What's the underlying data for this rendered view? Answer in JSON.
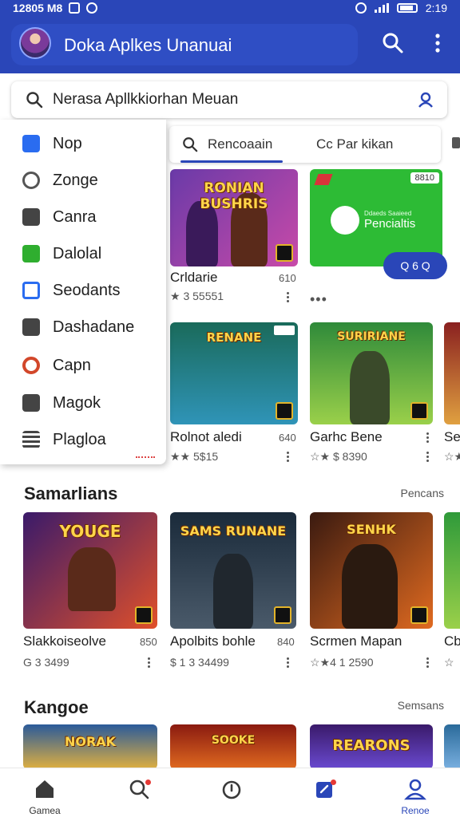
{
  "status_bar": {
    "time_left": "12805 M8",
    "time_right": "2:19"
  },
  "app_bar": {
    "title": "Doka Aplkes Unanuai"
  },
  "search": {
    "placeholder": "Nerasa Apllkkiorhan Meuan"
  },
  "drawer": {
    "items": [
      {
        "label": "Nop",
        "icon": "app-a-icon",
        "color": "#2a6cf0"
      },
      {
        "label": "Zonge",
        "icon": "person-group-icon",
        "color": "#555555"
      },
      {
        "label": "Canra",
        "icon": "tools-icon",
        "color": "#444444"
      },
      {
        "label": "Dalolal",
        "icon": "check-square-icon",
        "color": "#2fae2f"
      },
      {
        "label": "Seodants",
        "icon": "curve-icon",
        "color": "#2a6cf0"
      },
      {
        "label": "Dashadane",
        "icon": "envelope-icon",
        "color": "#444444"
      },
      {
        "label": "Capn",
        "icon": "g-circle-icon",
        "color": "#d2472a"
      },
      {
        "label": "Magok",
        "icon": "box-x-icon",
        "color": "#444444"
      },
      {
        "label": "Plagloa",
        "icon": "list-icon",
        "color": "#444444"
      }
    ]
  },
  "tabs": [
    {
      "label": "Rencoaain"
    },
    {
      "label": "Cc Par kikan"
    }
  ],
  "top_cards": [
    {
      "thumb_text": "RONIAN BUSHRIS",
      "title": "Crldarie",
      "size": "610",
      "rating": "★ 3 55551",
      "colors": [
        "#6a3aa8",
        "#c84aa8"
      ]
    },
    {
      "thumb_text": "RENANE",
      "title": "Rolnot aledi",
      "size": "640",
      "rating": "★★ 5$15",
      "colors": [
        "#1a6a5a",
        "#2f94b8"
      ]
    },
    {
      "thumb_text": "SURIRIANE",
      "title": "Garhc Bene",
      "size": "",
      "rating": "☆★ $ 8390",
      "colors": [
        "#2f8a3a",
        "#9ad04a"
      ]
    },
    {
      "thumb_text": "",
      "title": "Se",
      "size": "",
      "rating": "☆★",
      "colors": [
        "#8a2020",
        "#e0a040"
      ]
    }
  ],
  "feature_tile": {
    "title": "Pencialtis",
    "subtitle": "Ddaeds Saaieed",
    "badge": "8810"
  },
  "fab": {
    "label": "Q 6 Q"
  },
  "sections": [
    {
      "title": "Samarlians",
      "link": "Pencans",
      "cards": [
        {
          "thumb_text": "YOUGE",
          "title": "Slakkoiseolve",
          "size": "850",
          "rating": "G 3 3499",
          "colors": [
            "#3a1a6a",
            "#e0502a"
          ]
        },
        {
          "thumb_text": "SAMS RUNANE",
          "title": "Apolbits bohle",
          "size": "840",
          "rating": "$ 1 3 34499",
          "colors": [
            "#1a2a3a",
            "#4a5a6a"
          ]
        },
        {
          "thumb_text": "SENHK",
          "title": "Scrmen Mapan",
          "size": "",
          "rating": "☆★4 1 2590",
          "colors": [
            "#3a1a10",
            "#e06a20"
          ]
        },
        {
          "thumb_text": "",
          "title": "Cb",
          "size": "",
          "rating": "☆",
          "colors": [
            "#2f9a3a",
            "#9ad04a"
          ]
        }
      ]
    },
    {
      "title": "Kangoe",
      "link": "Semsans",
      "cards": [
        {
          "thumb_text": "NORAK",
          "colors": [
            "#2a5a9a",
            "#e0b040"
          ]
        },
        {
          "thumb_text": "SOOKE",
          "colors": [
            "#8a1a10",
            "#e06a20"
          ]
        },
        {
          "thumb_text": "REARONS",
          "colors": [
            "#3a1a6a",
            "#6a4ad0"
          ]
        },
        {
          "thumb_text": "",
          "colors": [
            "#2a6a9a",
            "#7ab0e0"
          ]
        }
      ]
    }
  ],
  "bottom_nav": [
    {
      "label": "Gamea",
      "icon": "home-icon"
    },
    {
      "label": "",
      "icon": "search-icon"
    },
    {
      "label": "",
      "icon": "timer-icon"
    },
    {
      "label": "",
      "icon": "edit-square-icon"
    },
    {
      "label": "Renoe",
      "icon": "profile-icon"
    }
  ],
  "colors": {
    "primary": "#2a46b8",
    "accent_green": "#2dbb35",
    "notification_red": "#e53935"
  }
}
